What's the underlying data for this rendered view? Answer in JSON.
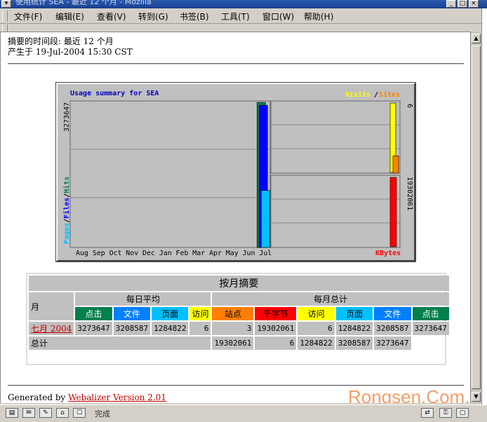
{
  "window": {
    "title": "使用统计 SEA - 最近 12 个月 - Mozilla"
  },
  "menu": [
    {
      "label": "文件(F)"
    },
    {
      "label": "编辑(E)"
    },
    {
      "label": "查看(V)"
    },
    {
      "label": "转到(G)"
    },
    {
      "label": "书签(B)"
    },
    {
      "label": "工具(T)"
    },
    {
      "label": "窗口(W)"
    },
    {
      "label": "帮助(H)"
    }
  ],
  "page": {
    "period_line": "摘要的时间段: 最近 12 个月",
    "generated_line": "产生于 19-Jul-2004 15:30 CST"
  },
  "graph": {
    "title": "Usage summary for SEA",
    "legend_visits": "Visits",
    "legend_slash": "/",
    "legend_sites": "Sites",
    "y_left_max": "3273647",
    "y_right_top": "6",
    "y_right_bottom": "19302061",
    "left_axis_pages": "Pages",
    "left_axis_files": "Files",
    "left_axis_hits": "Hits",
    "kbytes_label": "KBytes",
    "colors": {
      "hits": "#00804b",
      "files": "#0000ff",
      "pages": "#00c0ff",
      "visits": "#ffff00",
      "sites": "#ff8000",
      "kbytes": "#ff0000"
    }
  },
  "chart_data": {
    "type": "bar",
    "title": "Usage summary for SEA",
    "categories": [
      "Aug",
      "Sep",
      "Oct",
      "Nov",
      "Dec",
      "Jan",
      "Feb",
      "Mar",
      "Apr",
      "May",
      "Jun",
      "Jul"
    ],
    "series": [
      {
        "name": "Hits",
        "values": [
          0,
          0,
          0,
          0,
          0,
          0,
          0,
          0,
          0,
          0,
          0,
          3273647
        ]
      },
      {
        "name": "Files",
        "values": [
          0,
          0,
          0,
          0,
          0,
          0,
          0,
          0,
          0,
          0,
          0,
          3208587
        ]
      },
      {
        "name": "Pages",
        "values": [
          0,
          0,
          0,
          0,
          0,
          0,
          0,
          0,
          0,
          0,
          0,
          1284822
        ]
      },
      {
        "name": "Visits",
        "values": [
          6
        ]
      },
      {
        "name": "Sites",
        "values": [
          3
        ]
      },
      {
        "name": "KBytes",
        "values": [
          19302061
        ]
      }
    ]
  },
  "monthly": {
    "caption": "按月摘要",
    "month_header": "月",
    "daily_avg": "每日平均",
    "monthly_total": "每月总计",
    "headers": [
      "点击",
      "文件",
      "页面",
      "访问",
      "站点",
      "千字节",
      "访问",
      "页面",
      "文件",
      "点击"
    ],
    "row": {
      "month": "七月 2004",
      "values": [
        "3273647",
        "3208587",
        "1284822",
        "6",
        "3",
        "19302061",
        "6",
        "1284822",
        "3208587",
        "3273647"
      ]
    },
    "total": {
      "label": "总计",
      "values": [
        "19302061",
        "6",
        "1284822",
        "3208587",
        "3273647"
      ]
    }
  },
  "footer": {
    "generated_by": "Generated by",
    "webalizer": "Webalizer Version 2.01"
  },
  "watermark": "Rongsen.Com.Cn",
  "statusbar": {
    "status": "完成"
  }
}
